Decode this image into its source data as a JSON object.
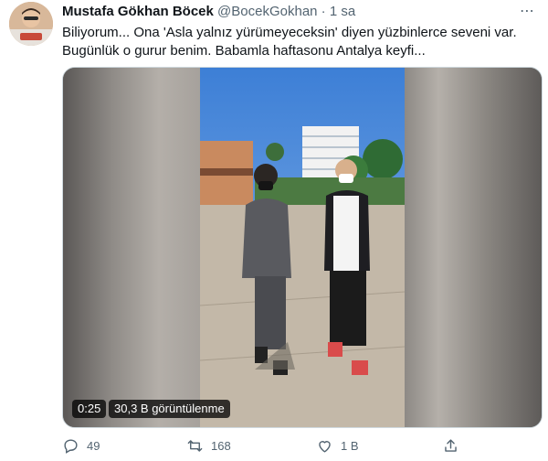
{
  "tweet": {
    "author_name": "Mustafa Gökhan Böcek",
    "author_handle": "@BocekGokhan",
    "separator": "·",
    "time": "1 sa",
    "more_icon": "more-icon",
    "text_line1": "Biliyorum... Ona 'Asla yalnız yürümeyeceksin' diyen yüzbinlerce seveni var.",
    "text_line2": "Bugünlük o gurur benim. Babamla haftasonu Antalya keyfi..."
  },
  "video": {
    "duration": "0:25",
    "views": "30,3 B görüntülenme"
  },
  "actions": {
    "reply_icon": "reply-icon",
    "reply_count": "49",
    "retweet_icon": "retweet-icon",
    "retweet_count": "168",
    "like_icon": "heart-icon",
    "like_count": "1 B",
    "share_icon": "share-icon"
  },
  "colors": {
    "text": "#0f1419",
    "secondary": "#536471",
    "border": "#cfd9de"
  }
}
